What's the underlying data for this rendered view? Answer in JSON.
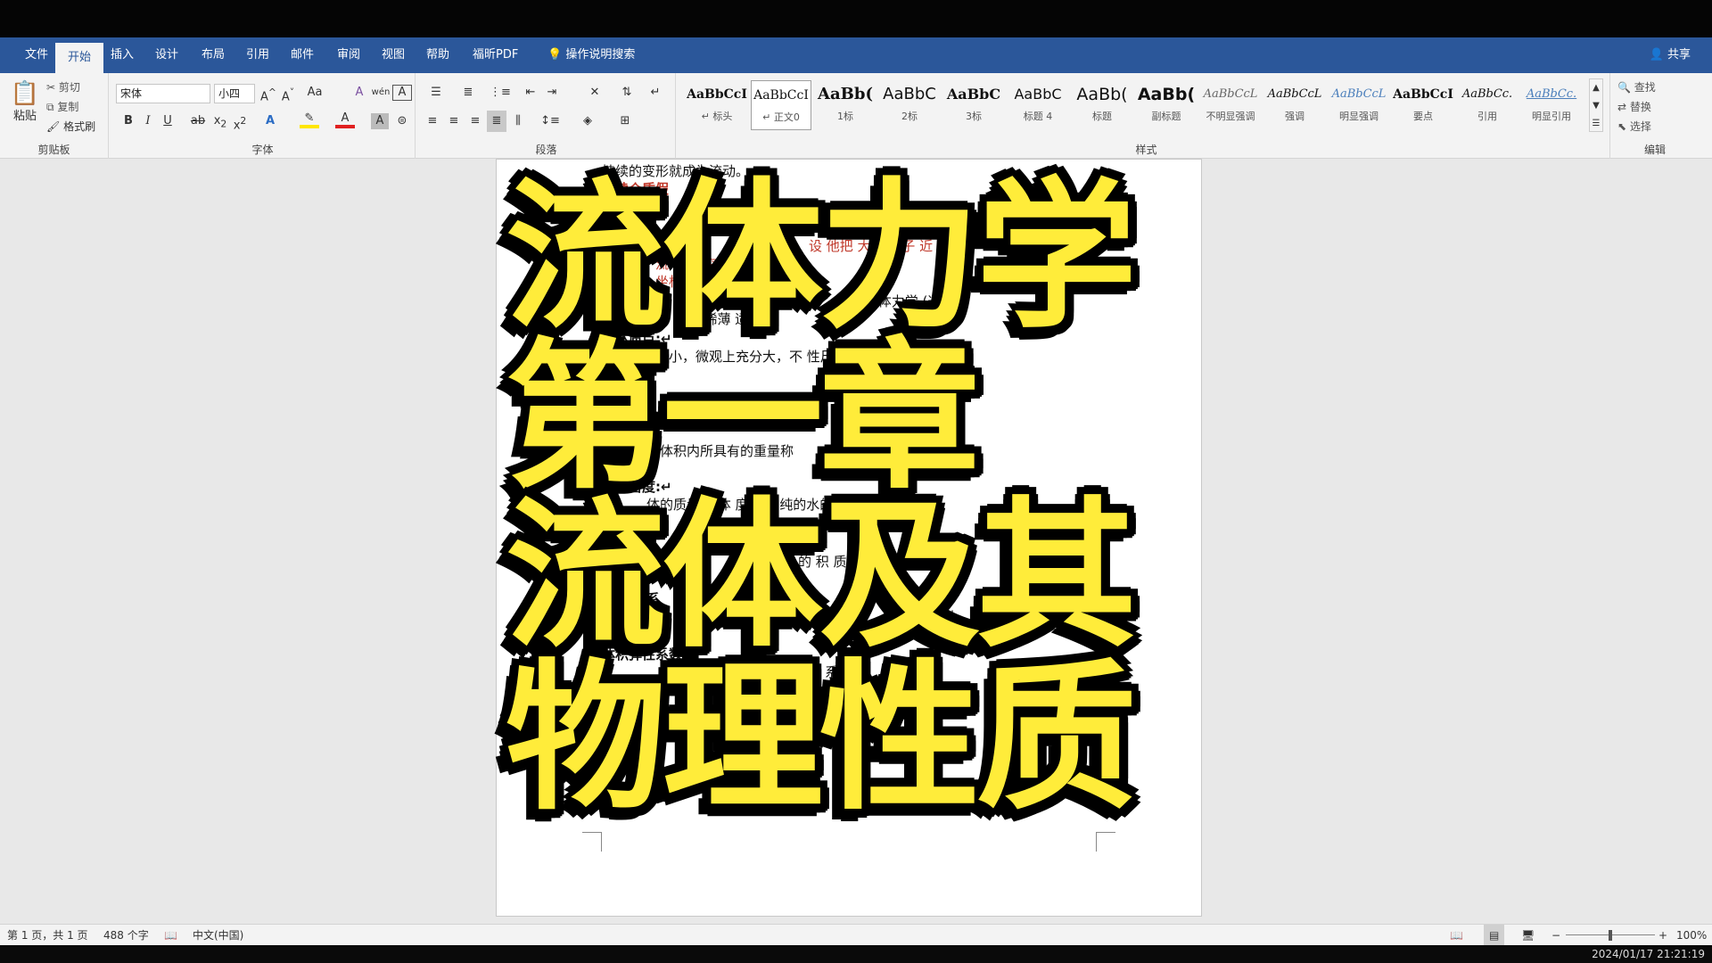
{
  "menu": {
    "tabs": [
      "文件",
      "开始",
      "插入",
      "设计",
      "布局",
      "引用",
      "邮件",
      "审阅",
      "视图",
      "帮助",
      "福昕PDF"
    ],
    "active_tab": "开始",
    "tell_me": "操作说明搜索",
    "share": "共享"
  },
  "ribbon": {
    "clipboard": {
      "paste": "粘贴",
      "cut": "剪切",
      "copy": "复制",
      "format_painter": "格式刷",
      "label": "剪贴板"
    },
    "font": {
      "name": "宋体",
      "size": "小四",
      "label": "字体"
    },
    "paragraph": {
      "label": "段落"
    },
    "styles": {
      "label": "样式",
      "items": [
        {
          "preview": "AaBbCcI",
          "name": "↵ 标头"
        },
        {
          "preview": "AaBbCcI",
          "name": "↵ 正文0"
        },
        {
          "preview": "AaBb(",
          "name": "1标"
        },
        {
          "preview": "AaBbC",
          "name": "2标"
        },
        {
          "preview": "AaBbC",
          "name": "3标"
        },
        {
          "preview": "AaBbC",
          "name": "标题 4"
        },
        {
          "preview": "AaBb(",
          "name": "标题"
        },
        {
          "preview": "AaBb(",
          "name": "副标题"
        },
        {
          "preview": "AaBbCcL",
          "name": "不明显强调"
        },
        {
          "preview": "AaBbCcL",
          "name": "强调"
        },
        {
          "preview": "AaBbCcL",
          "name": "明显强调"
        },
        {
          "preview": "AaBbCcI",
          "name": "要点"
        },
        {
          "preview": "AaBbCc.",
          "name": "引用"
        },
        {
          "preview": "AaBbCc.",
          "name": "明显引用"
        }
      ]
    },
    "editing": {
      "find": "查找",
      "replace": "替换",
      "select": "选择",
      "label": "编辑"
    }
  },
  "document": {
    "lines": [
      "持续的变形就成为流动。↵",
      "连续介质假",
      "质",
      "连",
      "介质假",
      "设 他把 大量高 子 近",
      "流 所在 空间的运",
      "坐标 间的连续",
      "讨 体力学 (这一假",
      "大 流体 稀薄 适用)",
      "流体质点:↵",
      "分小，微观上充分大，不 性尺度效应的分子团。↵",
      "位体积内所具有的重量称",
      "相对密度:↵",
      "体的质量与 体 度为 的纯的水的质量之比",
      "的 积 质",
      "系",
      "相对",
      "体积弹性系数:↵",
      "系"
    ],
    "title_lines": [
      "流体力学",
      "第一章",
      "流体及其",
      "物理性质"
    ]
  },
  "status": {
    "page": "第 1 页，共 1 页",
    "words": "488 个字",
    "language": "中文(中国)",
    "zoom": "100%"
  },
  "taskbar": {
    "datetime": "2024/01/17 21:21:19"
  }
}
